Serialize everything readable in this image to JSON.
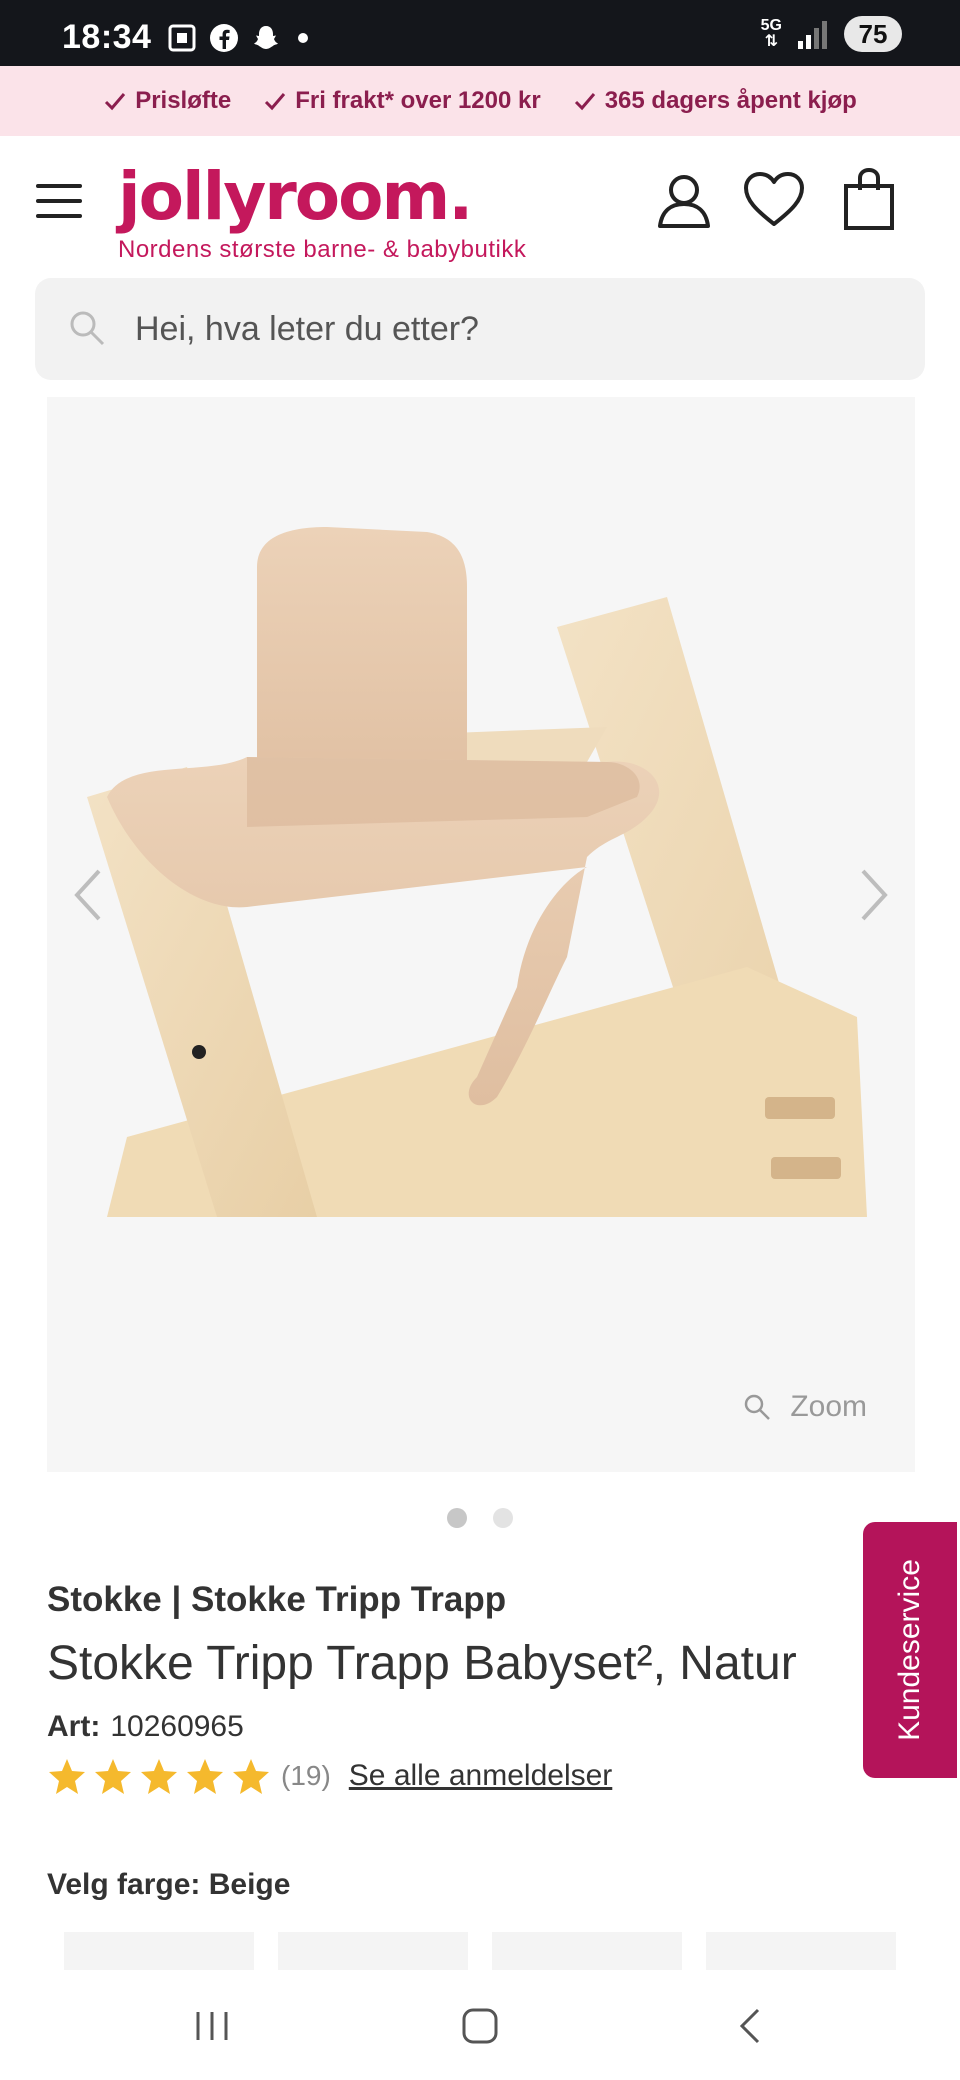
{
  "status_bar": {
    "time": "18:34",
    "network": "5G",
    "battery": "75",
    "left_icons": [
      "screenshot-icon",
      "facebook-icon",
      "snapchat-icon",
      "notification-dot"
    ]
  },
  "promo": {
    "items": [
      "Prisløfte",
      "Fri frakt* over 1200 kr",
      "365 dagers åpent kjøp"
    ],
    "text_color": "#8b1e4e",
    "bg_color": "#fbe3e9"
  },
  "header": {
    "logo": "jollyroom.",
    "tagline": "Nordens største barne- & babybutikk",
    "brand_color": "#c4185c",
    "icons": [
      "menu-icon",
      "account-icon",
      "wishlist-heart-icon",
      "shopping-bag-icon"
    ]
  },
  "search": {
    "placeholder": "Hei, hva leter du etter?"
  },
  "gallery": {
    "zoom_label": "Zoom",
    "image_count": 2,
    "active_index": 0
  },
  "product": {
    "brand_line": "Stokke | Stokke Tripp Trapp",
    "title": "Stokke Tripp Trapp Babyset², Natur",
    "art_label": "Art:",
    "art_number": "10260965",
    "rating_stars": 5,
    "review_count": "(19)",
    "reviews_link": "Se alle anmeldelser",
    "color_label": "Velg farge: Beige"
  },
  "kundeservice": {
    "label": "Kundeservice",
    "color": "#b4145a"
  },
  "nav": {
    "buttons": [
      "recent-apps-icon",
      "home-icon",
      "back-icon"
    ]
  }
}
